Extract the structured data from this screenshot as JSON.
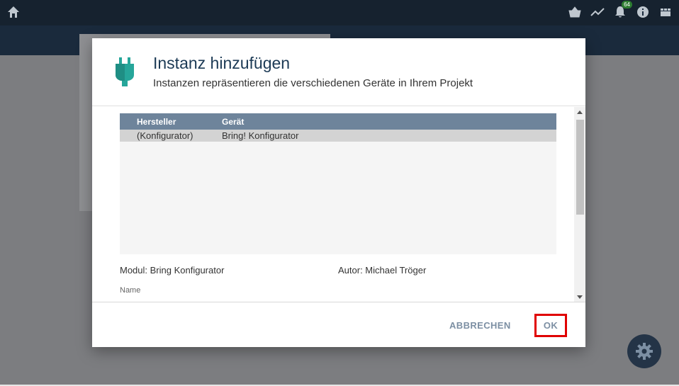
{
  "topbar": {
    "notification_count": "64",
    "icons": [
      "home-icon",
      "basket-icon",
      "trend-icon",
      "bell-icon",
      "info-icon",
      "grid-icon"
    ]
  },
  "dialog": {
    "title": "Instanz hinzufügen",
    "subtitle": "Instanzen repräsentieren die verschiedenen Geräte in Ihrem Projekt",
    "table": {
      "columns": [
        "Hersteller",
        "Gerät"
      ],
      "rows": [
        {
          "hersteller": "(Konfigurator)",
          "geraet": "Bring! Konfigurator"
        }
      ]
    },
    "modul": "Modul: Bring Konfigurator",
    "autor": "Autor: Michael Tröger",
    "name_label": "Name",
    "name_value": "",
    "cancel_label": "ABBRECHEN",
    "ok_label": "OK"
  },
  "colors": {
    "accent": "#1c3a55",
    "table_header": "#6e849b",
    "plug": "#26a69a",
    "highlight": "#e00000"
  }
}
